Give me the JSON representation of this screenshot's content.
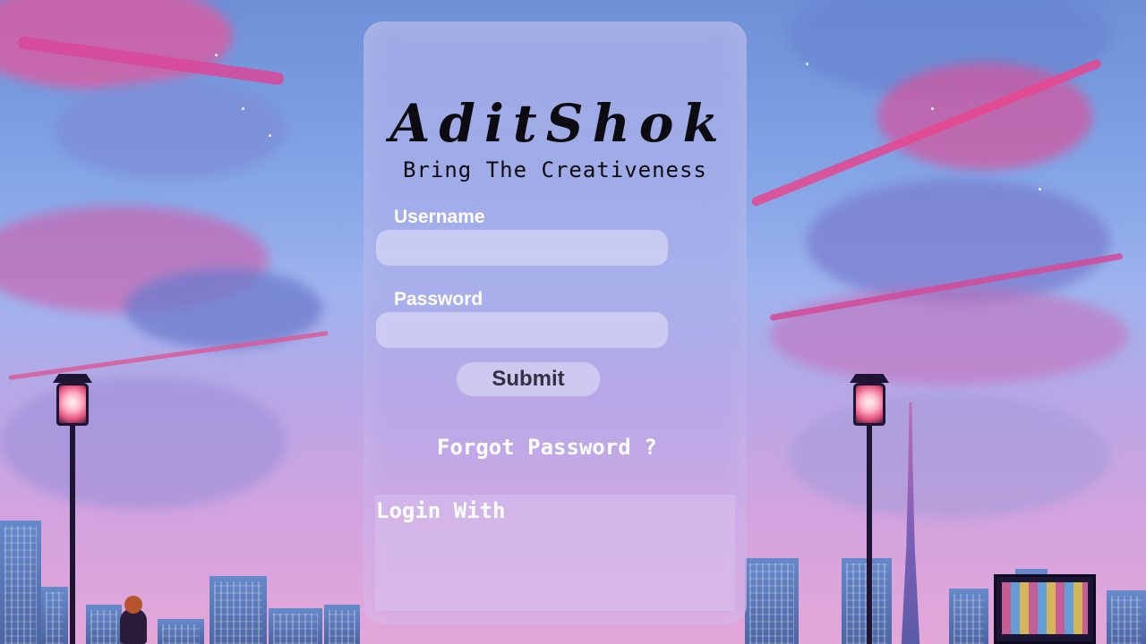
{
  "brand": {
    "name": "AditShok",
    "tagline": "Bring The Creativeness"
  },
  "form": {
    "username_label": "Username",
    "username_value": "",
    "password_label": "Password",
    "password_value": "",
    "submit_label": "Submit"
  },
  "links": {
    "forgot_password": "Forgot Password ?"
  },
  "social": {
    "label": "Login With"
  },
  "colors": {
    "panel_glass": "#b7aee8",
    "text_dark": "#0d0b12",
    "text_light": "#ffffff",
    "accent_pink": "#e2507a"
  }
}
